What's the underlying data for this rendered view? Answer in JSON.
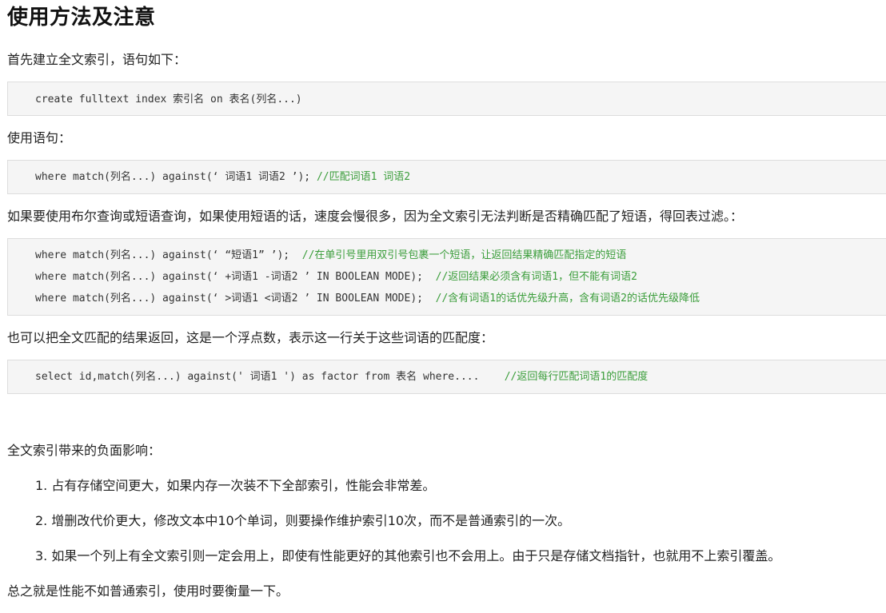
{
  "title": "使用方法及注意",
  "intro": "首先建立全文索引，语句如下：",
  "create_code": "create fulltext index 索引名 on 表名(列名...)",
  "usage_label": "使用语句：",
  "usage_code": "where match(列名...) against(‘ 词语1 词语2 ’); ",
  "usage_comment": "//匹配词语1 词语2",
  "boolean_intro": "如果要使用布尔查询或短语查询，如果使用短语的话，速度会慢很多，因为全文索引无法判断是否精确匹配了短语，得回表过滤。：",
  "boolean_lines": [
    {
      "code": "where match(列名...) against(‘ “短语1” ’);  ",
      "comment": "//在单引号里用双引号包裹一个短语，让返回结果精确匹配指定的短语"
    },
    {
      "code": "where match(列名...) against(‘ +词语1 -词语2 ’ IN BOOLEAN MODE);  ",
      "comment": "//返回结果必须含有词语1，但不能有词语2"
    },
    {
      "code": "where match(列名...) against(‘ >词语1 <词语2 ’ IN BOOLEAN MODE);  ",
      "comment": "//含有词语1的话优先级升高，含有词语2的话优先级降低"
    }
  ],
  "factor_intro": "也可以把全文匹配的结果返回，这是一个浮点数，表示这一行关于这些词语的匹配度：",
  "factor_code": "select id,match(列名...) against(' 词语1 ') as factor from 表名 where....    ",
  "factor_comment": "//返回每行匹配词语1的匹配度",
  "impact_label": "全文索引带来的负面影响：",
  "impacts": [
    "1. 占有存储空间更大，如果内存一次装不下全部索引，性能会非常差。",
    "2. 增删改代价更大，修改文本中10个单词，则要操作维护索引10次，而不是普通索引的一次。",
    "3. 如果一个列上有全文索引则一定会用上，即使有性能更好的其他索引也不会用上。由于只是存储文档指针，也就用不上索引覆盖。"
  ],
  "summary": "总之就是性能不如普通索引，使用时要衡量一下。"
}
